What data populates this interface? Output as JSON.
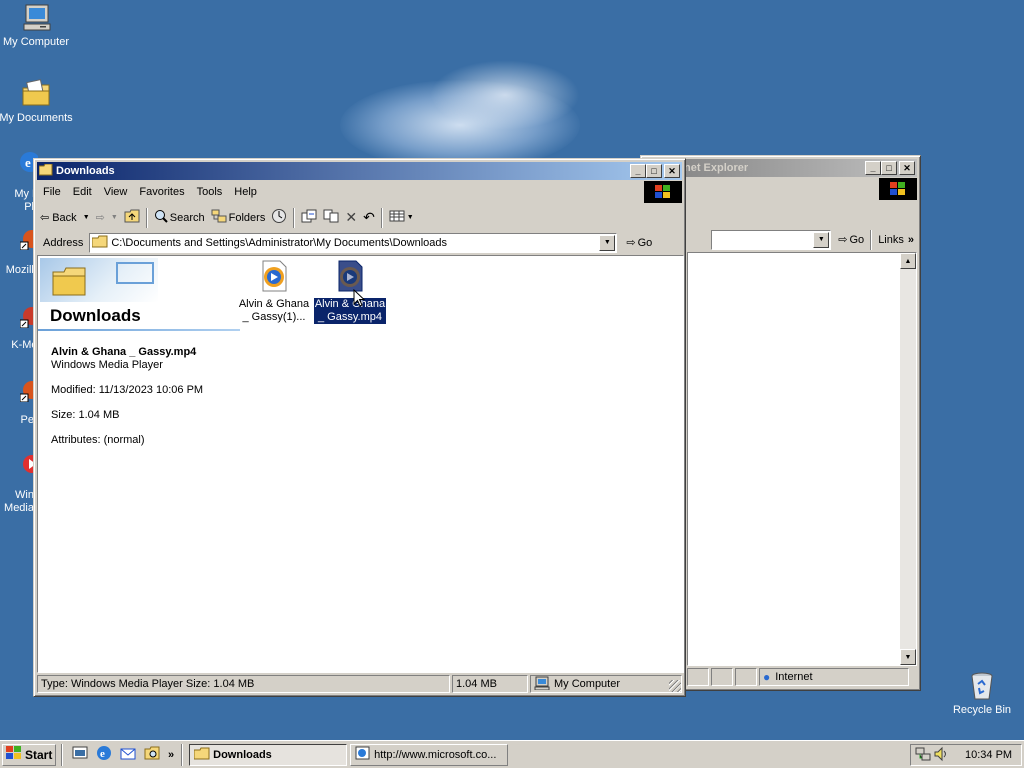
{
  "desktop": {
    "icons": [
      {
        "label": "My Computer"
      },
      {
        "label": "My Documents"
      },
      {
        "label": "Recycle Bin"
      }
    ],
    "partial_icons": [
      "My N",
      "Pl",
      "Mozilla",
      "K-Mel",
      "Pe",
      "Win",
      "Media"
    ]
  },
  "ie_window": {
    "title": "Internet Explorer",
    "title_visible": "net Explorer",
    "go_label": "Go",
    "links_label": "Links",
    "status_zone": "Internet"
  },
  "explorer": {
    "title": "Downloads",
    "menu": [
      "File",
      "Edit",
      "View",
      "Favorites",
      "Tools",
      "Help"
    ],
    "toolbar": {
      "back": "Back",
      "search": "Search",
      "folders": "Folders"
    },
    "address_label": "Address",
    "address_value": "C:\\Documents and Settings\\Administrator\\My Documents\\Downloads",
    "go_label": "Go",
    "panel": {
      "folder_title": "Downloads",
      "file_name": "Alvin & Ghana _ Gassy.mp4",
      "file_type": "Windows Media Player",
      "modified": "Modified: 11/13/2023 10:06 PM",
      "size": "Size: 1.04 MB",
      "attributes": "Attributes: (normal)"
    },
    "files": [
      {
        "line1": "Alvin & Ghana",
        "line2": "_ Gassy(1)...",
        "selected": false
      },
      {
        "line1": "Alvin & Ghana",
        "line2": "_ Gassy.mp4",
        "selected": true
      }
    ],
    "status": {
      "info": "Type: Windows Media Player Size: 1.04 MB",
      "size": "1.04 MB",
      "zone": "My Computer"
    }
  },
  "taskbar": {
    "start": "Start",
    "tasks": [
      {
        "label": "Downloads",
        "active": true
      },
      {
        "label": "http://www.microsoft.co...",
        "active": false
      }
    ],
    "clock": "10:34 PM"
  }
}
